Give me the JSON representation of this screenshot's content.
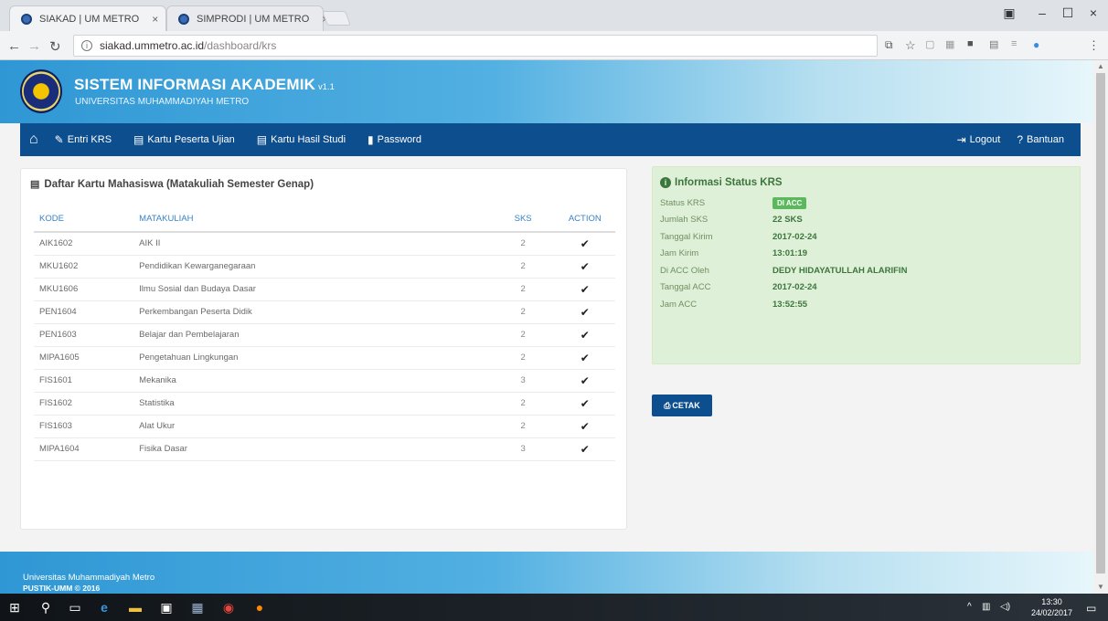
{
  "browser": {
    "tabs": [
      {
        "title": "SIAKAD | UM METRO",
        "close": "×"
      },
      {
        "title": "SIMPRODI | UM METRO",
        "close": "×"
      }
    ],
    "url_host": "siakad.ummetro.ac.id",
    "url_path": "/dashboard/krs",
    "window_controls": {
      "minimize": "–",
      "maximize": "☐",
      "close": "×"
    }
  },
  "app": {
    "title": "SISTEM INFORMASI AKADEMIK",
    "version": "v1.1",
    "subtitle": "UNIVERSITAS MUHAMMADIYAH METRO"
  },
  "nav": {
    "items": [
      {
        "label": "Entri KRS",
        "icon": "edit-icon"
      },
      {
        "label": "Kartu Peserta Ujian",
        "icon": "card-icon"
      },
      {
        "label": "Kartu Hasil Studi",
        "icon": "card-icon"
      },
      {
        "label": "Password",
        "icon": "lock-icon"
      }
    ],
    "right": [
      {
        "label": "Logout",
        "icon": "logout-icon"
      },
      {
        "label": "Bantuan",
        "icon": "help-icon"
      }
    ]
  },
  "krs_panel": {
    "title": "Daftar Kartu Mahasiswa (Matakuliah Semester Genap)",
    "columns": [
      "KODE",
      "MATAKULIAH",
      "SKS",
      "ACTION"
    ],
    "rows": [
      {
        "kode": "AIK1602",
        "matakuliah": "AIK II",
        "sks": "2",
        "action": "✔"
      },
      {
        "kode": "MKU1602",
        "matakuliah": "Pendidikan Kewarganegaraan",
        "sks": "2",
        "action": "✔"
      },
      {
        "kode": "MKU1606",
        "matakuliah": "Ilmu Sosial dan Budaya Dasar",
        "sks": "2",
        "action": "✔"
      },
      {
        "kode": "PEN1604",
        "matakuliah": "Perkembangan Peserta Didik",
        "sks": "2",
        "action": "✔"
      },
      {
        "kode": "PEN1603",
        "matakuliah": "Belajar dan Pembelajaran",
        "sks": "2",
        "action": "✔"
      },
      {
        "kode": "MIPA1605",
        "matakuliah": "Pengetahuan Lingkungan",
        "sks": "2",
        "action": "✔"
      },
      {
        "kode": "FIS1601",
        "matakuliah": "Mekanika",
        "sks": "3",
        "action": "✔"
      },
      {
        "kode": "FIS1602",
        "matakuliah": "Statistika",
        "sks": "2",
        "action": "✔"
      },
      {
        "kode": "FIS1603",
        "matakuliah": "Alat Ukur",
        "sks": "2",
        "action": "✔"
      },
      {
        "kode": "MIPA1604",
        "matakuliah": "Fisika Dasar",
        "sks": "3",
        "action": "✔"
      }
    ]
  },
  "status_panel": {
    "title": "Informasi Status KRS",
    "rows": [
      {
        "label": "Status KRS",
        "value": "DI ACC",
        "is_badge": true
      },
      {
        "label": "Jumlah SKS",
        "value": "22 SKS"
      },
      {
        "label": "Tanggal Kirim",
        "value": "2017-02-24"
      },
      {
        "label": "Jam Kirim",
        "value": "13:01:19"
      },
      {
        "label": "Di ACC Oleh",
        "value": "DEDY HIDAYATULLAH ALARIFIN"
      },
      {
        "label": "Tanggal ACC",
        "value": "2017-02-24"
      },
      {
        "label": "Jam ACC",
        "value": "13:52:55"
      }
    ]
  },
  "print_button": "CETAK",
  "footer": {
    "line1": "Universitas Muhammadiyah Metro",
    "line2": "PUSTIK-UMM © 2016"
  },
  "taskbar": {
    "time": "13:30",
    "date": "24/02/2017"
  },
  "colors": {
    "brand_dark": "#0d4e8e",
    "header_blue": "#2f97d4",
    "success_bg": "#dff0d8",
    "success_text": "#3c763d",
    "badge": "#5cb85c"
  }
}
